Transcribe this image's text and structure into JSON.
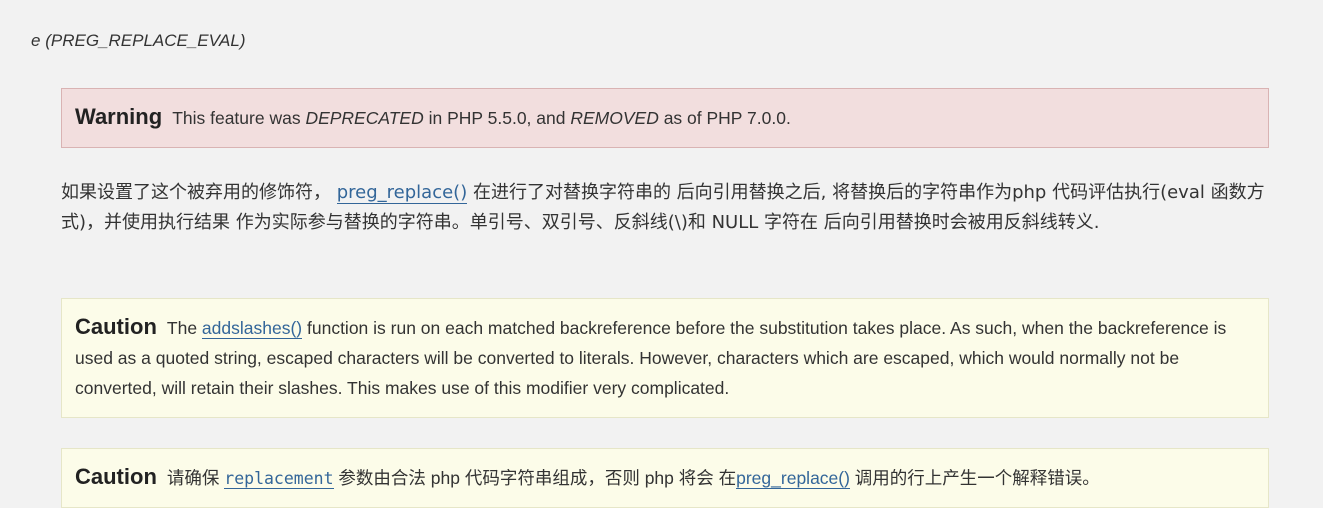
{
  "term": {
    "letter": "e",
    "name": "PREG_REPLACE_EVAL"
  },
  "warning": {
    "label": "Warning",
    "t1": "This feature was ",
    "deprecated": "DEPRECATED",
    "t2": " in PHP 5.5.0, and ",
    "removed": "REMOVED",
    "t3": " as of PHP 7.0.0."
  },
  "description": {
    "t1": "如果设置了这个被弃用的修饰符， ",
    "link": "preg_replace()",
    "t2": " 在进行了对替换字符串的 后向引用替换之后, 将替换后的字符串作为php 代码评估执行(eval 函数方式)，并使用执行结果 作为实际参与替换的字符串。单引号、双引号、反斜线(\\)和 NULL 字符在 后向引用替换时会被用反斜线转义."
  },
  "caution1": {
    "label": "Caution",
    "t1": "The ",
    "link": "addslashes()",
    "t2": " function is run on each matched backreference before the substitution takes place. As such, when the backreference is used as a quoted string, escaped characters will be converted to literals. However, characters which are escaped, which would normally not be converted, will retain their slashes. This makes use of this modifier very complicated."
  },
  "caution2": {
    "label": "Caution",
    "t1": "请确保 ",
    "code": "replacement",
    "t2": " 参数由合法 php 代码字符串组成，否则 php 将会 在",
    "link": "preg_replace()",
    "t3": " 调用的行上产生一个解释错误。"
  }
}
